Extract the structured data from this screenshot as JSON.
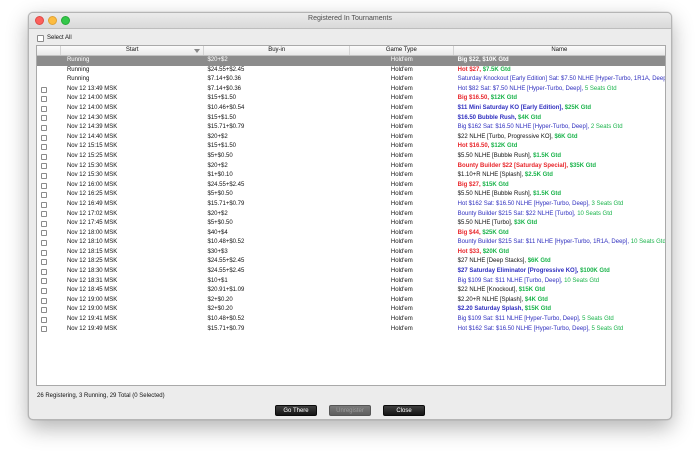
{
  "window": {
    "title": "Registered In Tournaments"
  },
  "select_all_label": "Select All",
  "columns": {
    "start": "Start",
    "buyin": "Buy-in",
    "type": "Game Type",
    "name": "Name"
  },
  "colors": {
    "white": "#ffffff",
    "black": "#111111",
    "red": "#e8262b",
    "green": "#19b34a",
    "blue": "#2f2fbf",
    "selected_row": "#8c8c8c"
  },
  "rows": [
    {
      "start": "Running",
      "buyin": "$20+$2",
      "type": "Hold'em",
      "checkbox": false,
      "selected": true,
      "name": [
        {
          "t": "Big $22, ",
          "c": "white",
          "b": true
        },
        {
          "t": "$10K Gtd",
          "c": "white",
          "b": true
        }
      ]
    },
    {
      "start": "Running",
      "buyin": "$24.55+$2.45",
      "type": "Hold'em",
      "checkbox": false,
      "name": [
        {
          "t": "Hot $27, ",
          "c": "red",
          "b": true
        },
        {
          "t": "$7.5K Gtd",
          "c": "green",
          "b": true
        }
      ]
    },
    {
      "start": "Running",
      "buyin": "$7.14+$0.36",
      "type": "Hold'em",
      "checkbox": false,
      "name": [
        {
          "t": "Saturday Knockout [Early Edition] Sat: $7.50 NLHE [Hyper-Turbo, 1R1A, Deep], ",
          "c": "blue",
          "b": false
        },
        {
          "t": "5 S...",
          "c": "green",
          "b": false
        }
      ]
    },
    {
      "start": "Nov 12  13:49 MSK",
      "buyin": "$7.14+$0.36",
      "type": "Hold'em",
      "checkbox": true,
      "name": [
        {
          "t": "Hot $82 Sat: $7.50 NLHE [Hyper-Turbo, Deep], ",
          "c": "blue",
          "b": false
        },
        {
          "t": "5 Seats Gtd",
          "c": "green",
          "b": false
        }
      ]
    },
    {
      "start": "Nov 12  14:00 MSK",
      "buyin": "$15+$1.50",
      "type": "Hold'em",
      "checkbox": true,
      "name": [
        {
          "t": "Big $16.50, ",
          "c": "red",
          "b": true
        },
        {
          "t": "$12K Gtd",
          "c": "green",
          "b": true
        }
      ]
    },
    {
      "start": "Nov 12  14:00 MSK",
      "buyin": "$10.46+$0.54",
      "type": "Hold'em",
      "checkbox": true,
      "name": [
        {
          "t": "$11 Mini Saturday KO [Early Edition], ",
          "c": "blue",
          "b": true
        },
        {
          "t": "$25K Gtd",
          "c": "green",
          "b": true
        }
      ]
    },
    {
      "start": "Nov 12  14:30 MSK",
      "buyin": "$15+$1.50",
      "type": "Hold'em",
      "checkbox": true,
      "name": [
        {
          "t": "$16.50 Bubble Rush, ",
          "c": "blue",
          "b": true
        },
        {
          "t": "$4K Gtd",
          "c": "green",
          "b": true
        }
      ]
    },
    {
      "start": "Nov 12  14:39 MSK",
      "buyin": "$15.71+$0.79",
      "type": "Hold'em",
      "checkbox": true,
      "name": [
        {
          "t": "Big $162 Sat: $16.50 NLHE [Hyper-Turbo, Deep], ",
          "c": "blue",
          "b": false
        },
        {
          "t": "2 Seats Gtd",
          "c": "green",
          "b": false
        }
      ]
    },
    {
      "start": "Nov 12  14:40 MSK",
      "buyin": "$20+$2",
      "type": "Hold'em",
      "checkbox": true,
      "name": [
        {
          "t": "$22 NLHE [Turbo, Progressive KO], ",
          "c": "black",
          "b": false
        },
        {
          "t": "$6K Gtd",
          "c": "green",
          "b": true
        }
      ]
    },
    {
      "start": "Nov 12  15:15 MSK",
      "buyin": "$15+$1.50",
      "type": "Hold'em",
      "checkbox": true,
      "name": [
        {
          "t": "Hot $16.50, ",
          "c": "red",
          "b": true
        },
        {
          "t": "$12K Gtd",
          "c": "green",
          "b": true
        }
      ]
    },
    {
      "start": "Nov 12  15:25 MSK",
      "buyin": "$5+$0.50",
      "type": "Hold'em",
      "checkbox": true,
      "name": [
        {
          "t": "$5.50 NLHE [Bubble Rush], ",
          "c": "black",
          "b": false
        },
        {
          "t": "$1.5K Gtd",
          "c": "green",
          "b": true
        }
      ]
    },
    {
      "start": "Nov 12  15:30 MSK",
      "buyin": "$20+$2",
      "type": "Hold'em",
      "checkbox": true,
      "name": [
        {
          "t": "Bounty Builder $22 [Saturday Special], ",
          "c": "red",
          "b": true
        },
        {
          "t": "$35K Gtd",
          "c": "green",
          "b": true
        }
      ]
    },
    {
      "start": "Nov 12  15:30 MSK",
      "buyin": "$1+$0.10",
      "type": "Hold'em",
      "checkbox": true,
      "name": [
        {
          "t": "$1.10+R NLHE [Splash], ",
          "c": "black",
          "b": false
        },
        {
          "t": "$2.5K Gtd",
          "c": "green",
          "b": true
        }
      ]
    },
    {
      "start": "Nov 12  16:00 MSK",
      "buyin": "$24.55+$2.45",
      "type": "Hold'em",
      "checkbox": true,
      "name": [
        {
          "t": "Big $27, ",
          "c": "red",
          "b": true
        },
        {
          "t": "$15K Gtd",
          "c": "green",
          "b": true
        }
      ]
    },
    {
      "start": "Nov 12  16:25 MSK",
      "buyin": "$5+$0.50",
      "type": "Hold'em",
      "checkbox": true,
      "name": [
        {
          "t": "$5.50 NLHE [Bubble Rush], ",
          "c": "black",
          "b": false
        },
        {
          "t": "$1.5K Gtd",
          "c": "green",
          "b": true
        }
      ]
    },
    {
      "start": "Nov 12  16:49 MSK",
      "buyin": "$15.71+$0.79",
      "type": "Hold'em",
      "checkbox": true,
      "name": [
        {
          "t": "Hot $162 Sat: $16.50 NLHE [Hyper-Turbo, Deep], ",
          "c": "blue",
          "b": false
        },
        {
          "t": "3 Seats Gtd",
          "c": "green",
          "b": false
        }
      ]
    },
    {
      "start": "Nov 12  17:02 MSK",
      "buyin": "$20+$2",
      "type": "Hold'em",
      "checkbox": true,
      "name": [
        {
          "t": "Bounty Builder $215 Sat: $22 NLHE [Turbo], ",
          "c": "blue",
          "b": false
        },
        {
          "t": "10 Seats Gtd",
          "c": "green",
          "b": false
        }
      ]
    },
    {
      "start": "Nov 12  17:45 MSK",
      "buyin": "$5+$0.50",
      "type": "Hold'em",
      "checkbox": true,
      "name": [
        {
          "t": "$5.50 NLHE [Turbo], ",
          "c": "black",
          "b": false
        },
        {
          "t": "$3K Gtd",
          "c": "green",
          "b": true
        }
      ]
    },
    {
      "start": "Nov 12  18:00 MSK",
      "buyin": "$40+$4",
      "type": "Hold'em",
      "checkbox": true,
      "name": [
        {
          "t": "Big $44, ",
          "c": "red",
          "b": true
        },
        {
          "t": "$25K Gtd",
          "c": "green",
          "b": true
        }
      ]
    },
    {
      "start": "Nov 12  18:10 MSK",
      "buyin": "$10.48+$0.52",
      "type": "Hold'em",
      "checkbox": true,
      "name": [
        {
          "t": "Bounty Builder $215 Sat: $11 NLHE [Hyper-Turbo, 1R1A, Deep], ",
          "c": "blue",
          "b": false
        },
        {
          "t": "10 Seats Gtd",
          "c": "green",
          "b": false
        }
      ]
    },
    {
      "start": "Nov 12  18:15 MSK",
      "buyin": "$30+$3",
      "type": "Hold'em",
      "checkbox": true,
      "name": [
        {
          "t": "Hot $33, ",
          "c": "red",
          "b": true
        },
        {
          "t": "$20K Gtd",
          "c": "green",
          "b": true
        }
      ]
    },
    {
      "start": "Nov 12  18:25 MSK",
      "buyin": "$24.55+$2.45",
      "type": "Hold'em",
      "checkbox": true,
      "name": [
        {
          "t": "$27 NLHE [Deep Stacks], ",
          "c": "black",
          "b": false
        },
        {
          "t": "$6K Gtd",
          "c": "green",
          "b": true
        }
      ]
    },
    {
      "start": "Nov 12  18:30 MSK",
      "buyin": "$24.55+$2.45",
      "type": "Hold'em",
      "checkbox": true,
      "name": [
        {
          "t": "$27 Saturday Eliminator [Progressive KO], ",
          "c": "blue",
          "b": true
        },
        {
          "t": "$100K Gtd",
          "c": "green",
          "b": true
        }
      ]
    },
    {
      "start": "Nov 12  18:31 MSK",
      "buyin": "$10+$1",
      "type": "Hold'em",
      "checkbox": true,
      "name": [
        {
          "t": "Big $109 Sat: $11 NLHE [Turbo, Deep], ",
          "c": "blue",
          "b": false
        },
        {
          "t": "10 Seats Gtd",
          "c": "green",
          "b": false
        }
      ]
    },
    {
      "start": "Nov 12  18:45 MSK",
      "buyin": "$20.91+$1.09",
      "type": "Hold'em",
      "checkbox": true,
      "name": [
        {
          "t": "$22 NLHE [Knockout], ",
          "c": "black",
          "b": false
        },
        {
          "t": "$15K Gtd",
          "c": "green",
          "b": true
        }
      ]
    },
    {
      "start": "Nov 12  19:00 MSK",
      "buyin": "$2+$0.20",
      "type": "Hold'em",
      "checkbox": true,
      "name": [
        {
          "t": "$2.20+R NLHE [Splash], ",
          "c": "black",
          "b": false
        },
        {
          "t": "$4K Gtd",
          "c": "green",
          "b": true
        }
      ]
    },
    {
      "start": "Nov 12  19:00 MSK",
      "buyin": "$2+$0.20",
      "type": "Hold'em",
      "checkbox": true,
      "name": [
        {
          "t": "$2.20 Saturday Splash, ",
          "c": "blue",
          "b": true
        },
        {
          "t": "$15K Gtd",
          "c": "green",
          "b": true
        }
      ]
    },
    {
      "start": "Nov 12  19:41 MSK",
      "buyin": "$10.48+$0.52",
      "type": "Hold'em",
      "checkbox": true,
      "name": [
        {
          "t": "Big $109 Sat: $11 NLHE [Hyper-Turbo, Deep], ",
          "c": "blue",
          "b": false
        },
        {
          "t": "5 Seats Gtd",
          "c": "green",
          "b": false
        }
      ]
    },
    {
      "start": "Nov 12  19:49 MSK",
      "buyin": "$15.71+$0.79",
      "type": "Hold'em",
      "checkbox": true,
      "name": [
        {
          "t": "Hot $162 Sat: $16.50 NLHE [Hyper-Turbo, Deep], ",
          "c": "blue",
          "b": false
        },
        {
          "t": "5 Seats Gtd",
          "c": "green",
          "b": false
        }
      ]
    }
  ],
  "status_text": "26 Registering, 3 Running, 29 Total (0 Selected)",
  "buttons": {
    "go_there": "Go There",
    "unregister": "Unregister",
    "close": "Close"
  },
  "icons": {
    "sort": "sort-descending-icon"
  }
}
